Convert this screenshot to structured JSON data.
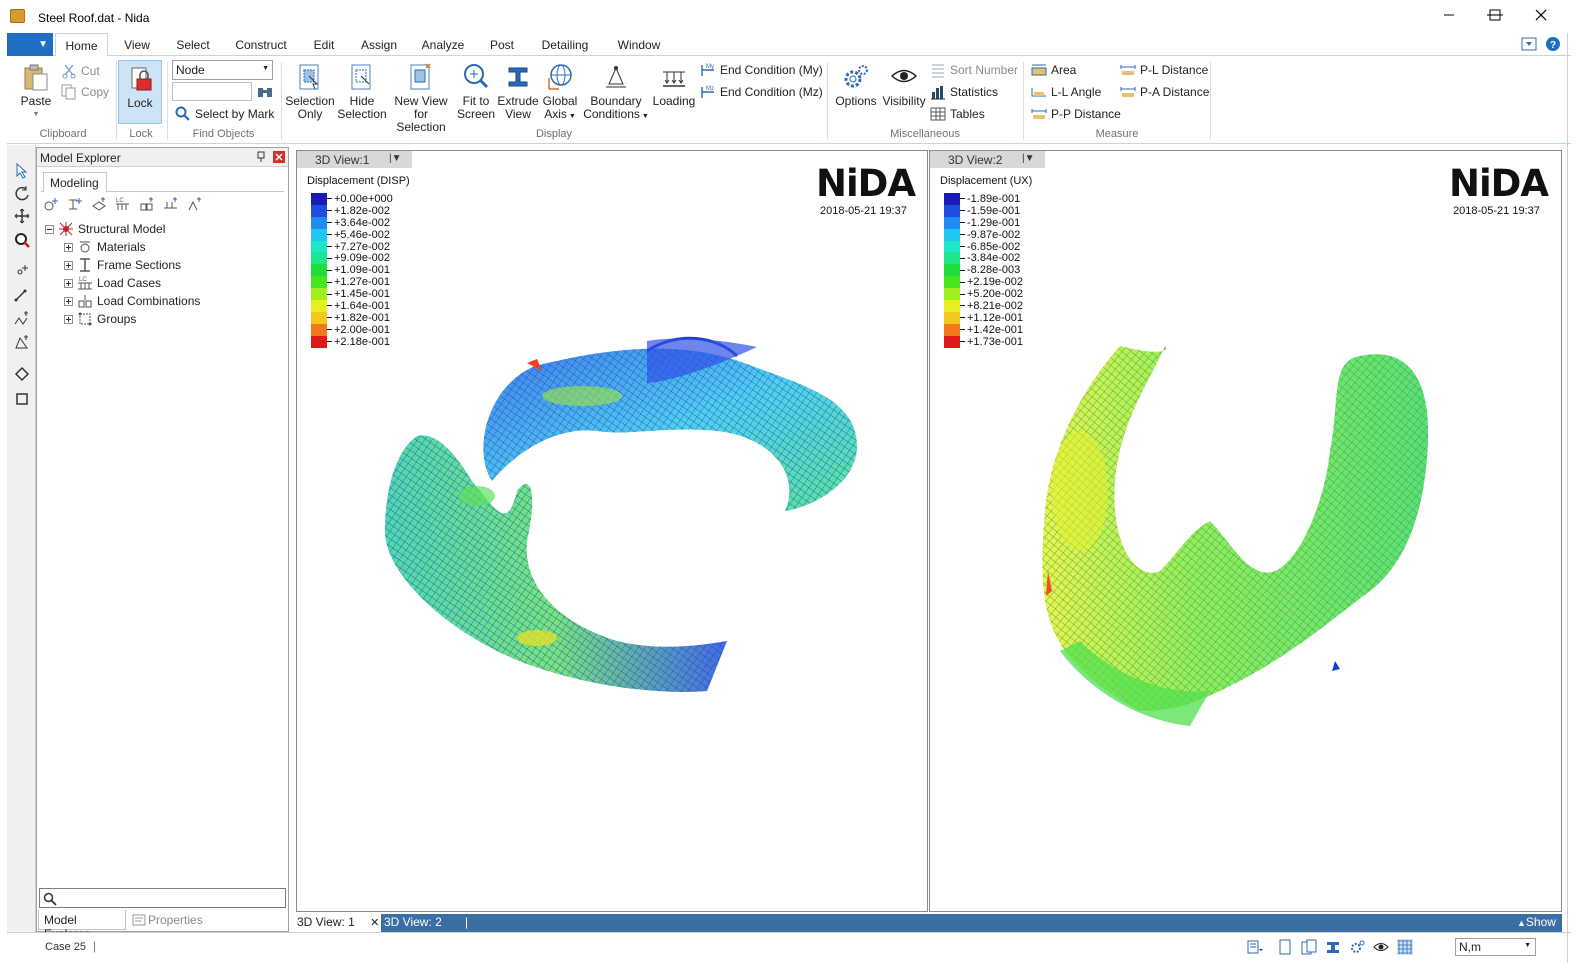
{
  "window": {
    "title": "Steel Roof.dat - Nida"
  },
  "ribbon": {
    "tabs": [
      "Home",
      "View",
      "Select",
      "Construct",
      "Edit",
      "Assign",
      "Analyze",
      "Post",
      "Detailing",
      "Window"
    ],
    "active_tab": "Home",
    "clipboard": {
      "group": "Clipboard",
      "paste": "Paste",
      "cut": "Cut",
      "copy": "Copy"
    },
    "lock": {
      "group": "Lock",
      "label": "Lock"
    },
    "find_objects": {
      "group": "Find Objects",
      "type_value": "Node",
      "select_by_mark": "Select by Mark"
    },
    "display": {
      "group": "Display",
      "selection_only_1": "Selection",
      "selection_only_2": "Only",
      "hide_selection_1": "Hide",
      "hide_selection_2": "Selection",
      "new_view_1": "New View",
      "new_view_2": "for Selection",
      "fit_1": "Fit to",
      "fit_2": "Screen",
      "extrude_1": "Extrude",
      "extrude_2": "View",
      "global_1": "Global",
      "global_2": "Axis",
      "boundary_1": "Boundary",
      "boundary_2": "Conditions",
      "loading": "Loading",
      "end_my": "End Condition (My)",
      "end_mz": "End Condition (Mz)"
    },
    "misc": {
      "group": "Miscellaneous",
      "options": "Options",
      "visibility": "Visibility",
      "sort_number": "Sort Number",
      "statistics": "Statistics",
      "tables": "Tables"
    },
    "measure": {
      "group": "Measure",
      "area": "Area",
      "ll_angle": "L-L Angle",
      "pp_distance": "P-P Distance",
      "pl_distance": "P-L Distance",
      "pa_distance": "P-A Distance"
    }
  },
  "explorer": {
    "title": "Model Explorer",
    "tab": "Modeling",
    "tree": {
      "root": "Structural Model",
      "items": [
        "Materials",
        "Frame Sections",
        "Load Cases",
        "Load Combinations",
        "Groups"
      ]
    },
    "bottom_tabs": [
      "Model Explorer",
      "Properties"
    ]
  },
  "views": [
    {
      "tab": "3D View:1",
      "logo": "NiDA",
      "timestamp": "2018-05-21 19:37",
      "legend_title": "Displacement (DISP)",
      "legend_values": [
        "+0.00e+000",
        "+1.82e-002",
        "+3.64e-002",
        "+5.46e-002",
        "+7.27e-002",
        "+9.09e-002",
        "+1.09e-001",
        "+1.27e-001",
        "+1.45e-001",
        "+1.64e-001",
        "+1.82e-001",
        "+2.00e-001",
        "+2.18e-001"
      ]
    },
    {
      "tab": "3D View:2",
      "logo": "NiDA",
      "timestamp": "2018-05-21 19:37",
      "legend_title": "Displacement (UX)",
      "legend_values": [
        "-1.89e-001",
        "-1.59e-001",
        "-1.29e-001",
        "-9.87e-002",
        "-6.85e-002",
        "-3.84e-002",
        "-8.28e-003",
        "+2.19e-002",
        "+5.20e-002",
        "+8.21e-002",
        "+1.12e-001",
        "+1.42e-001",
        "+1.73e-001"
      ]
    }
  ],
  "legend_colors": [
    "#1a1ab8",
    "#1f4de0",
    "#1e8cf0",
    "#1ec8f0",
    "#1ee6c8",
    "#1ee68c",
    "#1edc3c",
    "#46e61e",
    "#a0f01e",
    "#e6f01e",
    "#f0c81e",
    "#f07818",
    "#e01818"
  ],
  "doc_tabs": [
    "3D View: 1",
    "3D View: 2"
  ],
  "show_label": "Show",
  "status": {
    "case": "Case 25",
    "units": "N,m"
  },
  "colors": {
    "accent": "#1e6fc4",
    "doc_tab_bar": "#3b6ea5"
  }
}
